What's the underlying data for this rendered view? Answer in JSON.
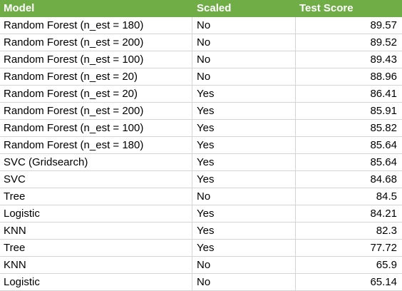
{
  "table": {
    "headers": {
      "model": "Model",
      "scaled": "Scaled",
      "score": "Test Score"
    },
    "rows": [
      {
        "model": "Random Forest (n_est = 180)",
        "scaled": "No",
        "score": "89.57"
      },
      {
        "model": "Random Forest (n_est = 200)",
        "scaled": "No",
        "score": "89.52"
      },
      {
        "model": "Random Forest (n_est = 100)",
        "scaled": "No",
        "score": "89.43"
      },
      {
        "model": "Random Forest (n_est = 20)",
        "scaled": "No",
        "score": "88.96"
      },
      {
        "model": "Random Forest (n_est = 20)",
        "scaled": "Yes",
        "score": "86.41"
      },
      {
        "model": "Random Forest (n_est = 200)",
        "scaled": "Yes",
        "score": "85.91"
      },
      {
        "model": "Random Forest (n_est = 100)",
        "scaled": "Yes",
        "score": "85.82"
      },
      {
        "model": "Random Forest (n_est = 180)",
        "scaled": "Yes",
        "score": "85.64"
      },
      {
        "model": "SVC (Gridsearch)",
        "scaled": "Yes",
        "score": "85.64"
      },
      {
        "model": "SVC",
        "scaled": "Yes",
        "score": "84.68"
      },
      {
        "model": "Tree",
        "scaled": "No",
        "score": "84.5"
      },
      {
        "model": "Logistic",
        "scaled": "Yes",
        "score": "84.21"
      },
      {
        "model": "KNN",
        "scaled": "Yes",
        "score": "82.3"
      },
      {
        "model": "Tree",
        "scaled": "Yes",
        "score": "77.72"
      },
      {
        "model": "KNN",
        "scaled": "No",
        "score": "65.9"
      },
      {
        "model": "Logistic",
        "scaled": "No",
        "score": "65.14"
      }
    ]
  },
  "colors": {
    "header_background": "#70ad47",
    "header_text": "#ffffff",
    "grid_line": "#d4d4d4"
  }
}
